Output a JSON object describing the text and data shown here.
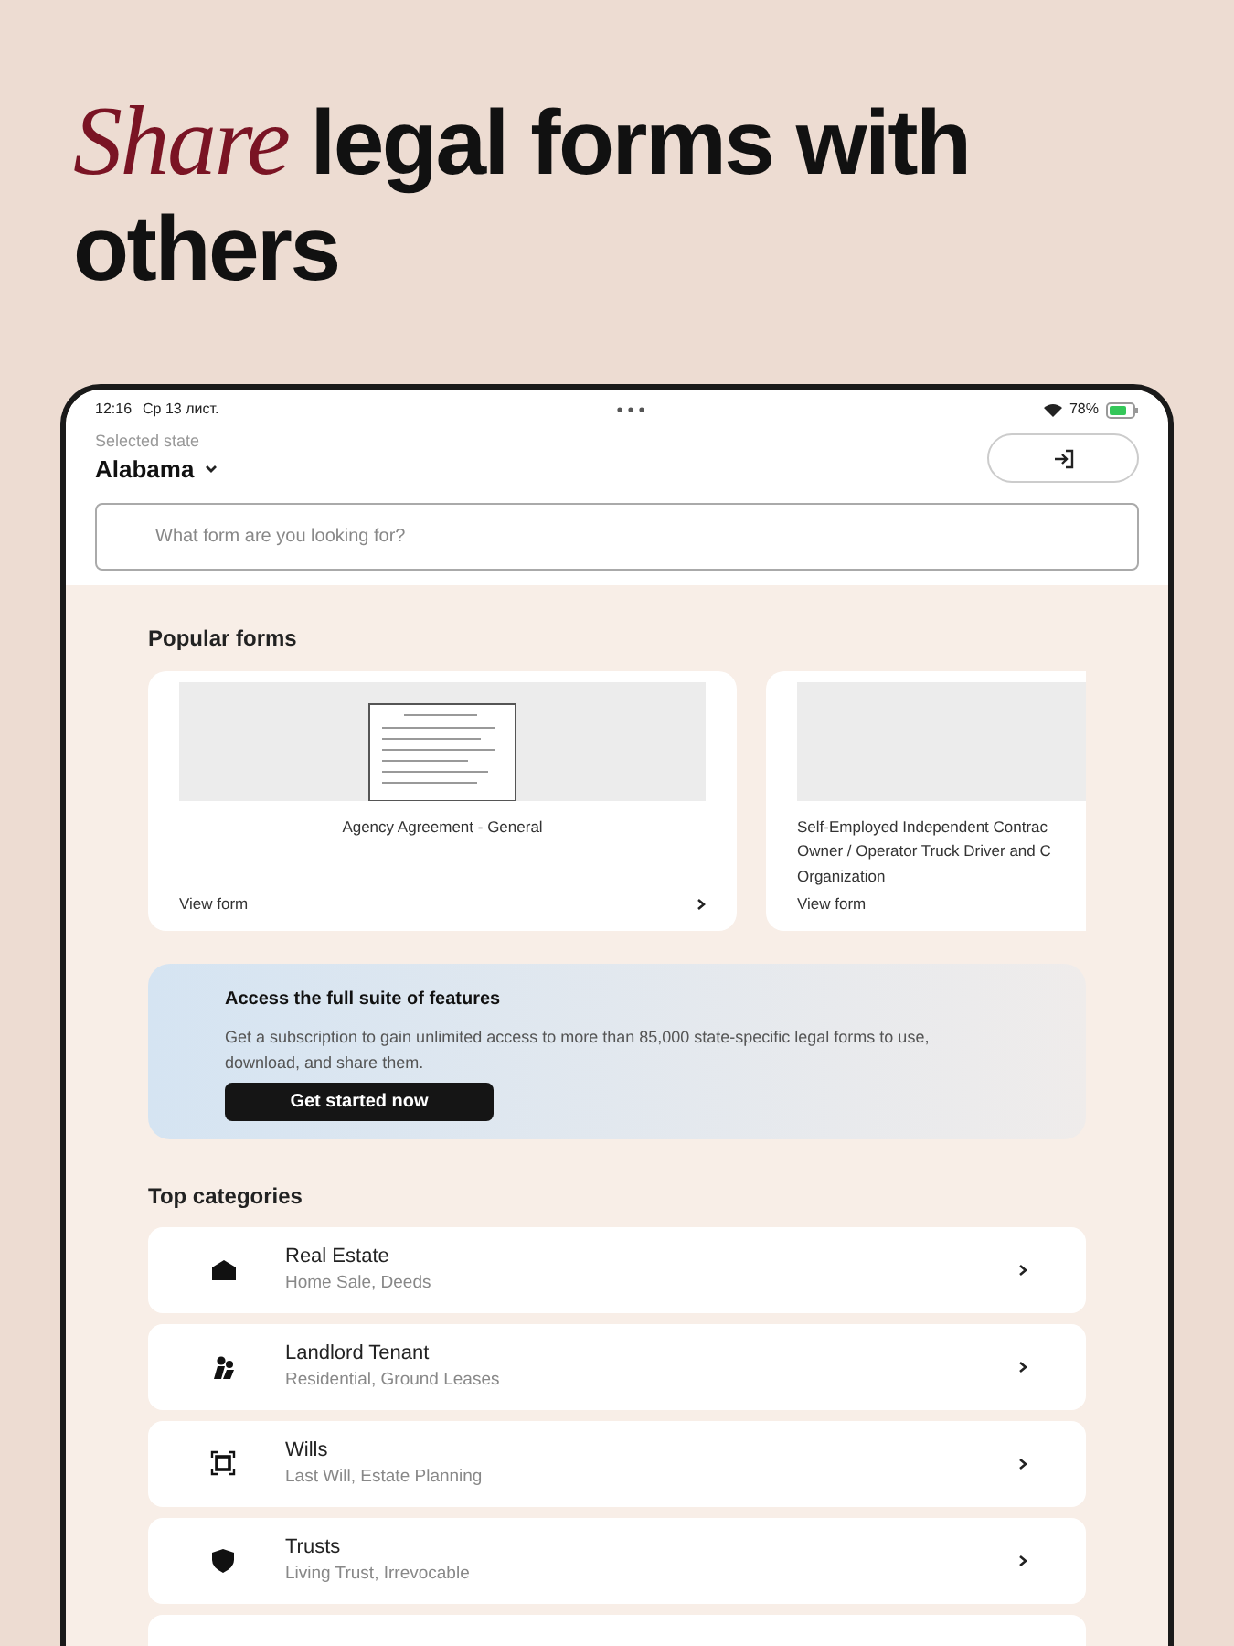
{
  "headline": {
    "accent": "Share",
    "rest": "legal forms with others"
  },
  "status_bar": {
    "time": "12:16",
    "date": "Ср 13 лист.",
    "battery": "78%"
  },
  "header": {
    "state_label": "Selected state",
    "state": "Alabama",
    "search": {
      "placeholder": "What form are you looking for?"
    }
  },
  "popular": {
    "title": "Popular forms",
    "cards": [
      {
        "title_lines": [
          "Agency Agreement - General"
        ],
        "link": "View form"
      },
      {
        "title_lines": [
          "Self-Employed Independent Contrac",
          "Owner / Operator Truck Driver and C",
          "Organization"
        ],
        "link": "View form"
      }
    ]
  },
  "promo": {
    "title": "Access the full suite of features",
    "text": "Get a subscription to gain unlimited access to more than 85,000 state-specific legal forms to use, download, and share them.",
    "button": "Get started now"
  },
  "categories": {
    "title": "Top categories",
    "items": [
      {
        "kind": "house",
        "name": "Real Estate",
        "sub": "Home Sale, Deeds"
      },
      {
        "kind": "people",
        "name": "Landlord Tenant",
        "sub": "Residential, Ground Leases"
      },
      {
        "kind": "frame",
        "name": "Wills",
        "sub": "Last Will, Estate Planning"
      },
      {
        "kind": "shield",
        "name": "Trusts",
        "sub": "Living Trust, Irrevocable"
      }
    ]
  }
}
